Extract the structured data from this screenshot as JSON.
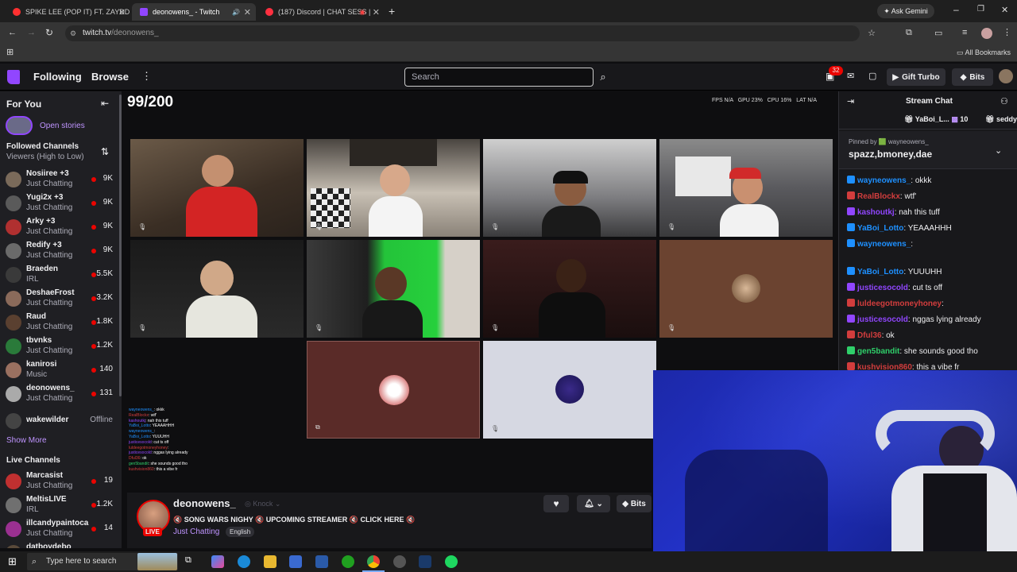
{
  "browser": {
    "tabs": [
      {
        "title": "SPIKE LEE (POP IT) FT. ZAYDD &"
      },
      {
        "title": "deonowens_ - Twitch"
      },
      {
        "title": "(187) Discord | CHAT SESS |"
      }
    ],
    "ask_gemini": "Ask Gemini",
    "url_host": "twitch.tv",
    "url_path": "/deonowens_",
    "all_bookmarks": "All Bookmarks"
  },
  "topnav": {
    "following": "Following",
    "browse": "Browse",
    "search_placeholder": "Search",
    "notif_count": "32",
    "gift_turbo": "Gift Turbo",
    "bits": "Bits"
  },
  "sidebar": {
    "for_you": "For You",
    "open_stories": "Open stories",
    "followed_title": "Followed Channels",
    "followed_sort": "Viewers (High to Low)",
    "followed": [
      {
        "name": "Nosiiree +3",
        "category": "Just Chatting",
        "viewers": "9K",
        "color": "#7a6a5a"
      },
      {
        "name": "Yugi2x +3",
        "category": "Just Chatting",
        "viewers": "9K",
        "color": "#5a5a5a"
      },
      {
        "name": "Arky +3",
        "category": "Just Chatting",
        "viewers": "9K",
        "color": "#b03030"
      },
      {
        "name": "Redify +3",
        "category": "Just Chatting",
        "viewers": "9K",
        "color": "#6a6a6a"
      },
      {
        "name": "Braeden",
        "category": "IRL",
        "viewers": "5.5K",
        "color": "#3a3a3a"
      },
      {
        "name": "DeshaeFrost",
        "category": "Just Chatting",
        "viewers": "3.2K",
        "color": "#8a6a5a"
      },
      {
        "name": "Raud",
        "category": "Just Chatting",
        "viewers": "1.8K",
        "color": "#5a4030"
      },
      {
        "name": "tbvnks",
        "category": "Just Chatting",
        "viewers": "1.2K",
        "color": "#2a7a3a"
      },
      {
        "name": "kanirosi",
        "category": "Music",
        "viewers": "140",
        "color": "#9a7060"
      },
      {
        "name": "deonowens_",
        "category": "Just Chatting",
        "viewers": "131",
        "color": "#aaaaaa"
      }
    ],
    "offline": {
      "name": "wakewilder",
      "status": "Offline"
    },
    "show_more": "Show More",
    "live_title": "Live Channels",
    "live": [
      {
        "name": "Marcasist",
        "category": "Just Chatting",
        "viewers": "19",
        "color": "#c03030"
      },
      {
        "name": "MeltisLIVE",
        "category": "IRL",
        "viewers": "1.2K",
        "color": "#707070"
      },
      {
        "name": "illcandypaintoca",
        "category": "Just Chatting",
        "viewers": "14",
        "color": "#9a3090"
      },
      {
        "name": "datboydebo",
        "category": "",
        "viewers": "142",
        "color": "#5a4a3a"
      }
    ]
  },
  "stream": {
    "counter": "99/200",
    "stats": [
      "FPS N/A",
      "GPU 23%",
      "CPU 16%",
      "LAT N/A"
    ]
  },
  "channel": {
    "name": "deonowens_",
    "live": "LIVE",
    "knock": "Knock",
    "title": "🔇 SONG WARS NIGHY 🔇 UPCOMING STREAMER 🔇 CLICK HERE 🔇",
    "category": "Just Chatting",
    "tag": "English",
    "bits": "Bits"
  },
  "chat": {
    "header": "Stream Chat",
    "pinned_by": "Pinned by 🟩 wayneowens_",
    "pinned_text": "spazz,bmoney,dae",
    "top_user": "YaBoi_L...",
    "top_count": "10",
    "top_user2": "seddy",
    "messages": [
      {
        "user": "wayneowens_",
        "color": "#1e90ff",
        "text": ": okkk"
      },
      {
        "user": "RealBlockx",
        "color": "#d23d3d",
        "text": ": wtf'"
      },
      {
        "user": "kashoutkj",
        "color": "#9146ff",
        "text": ": nah this tuff"
      },
      {
        "user": "YaBoi_Lotto",
        "color": "#1e90ff",
        "text": ": YEAAAHHH"
      },
      {
        "user": "wayneowens_",
        "color": "#1e90ff",
        "text": ":"
      },
      {
        "user": "YaBoi_Lotto",
        "color": "#1e90ff",
        "text": ": YUUUHH"
      },
      {
        "user": "justicesocold",
        "color": "#9146ff",
        "text": ": cut ts off"
      },
      {
        "user": "luldeegotmoneyhoney",
        "color": "#d23d3d",
        "text": ":"
      },
      {
        "user": "justicesocold",
        "color": "#9146ff",
        "text": ": nggas lying already"
      },
      {
        "user": "Dful36",
        "color": "#d23d3d",
        "text": ": ok"
      },
      {
        "user": "gen5bandit",
        "color": "#2fcf6a",
        "text": ": she sounds good tho"
      },
      {
        "user": "kushvision860",
        "color": "#d23d3d",
        "text": ": this a vibe fr"
      }
    ]
  },
  "taskbar": {
    "search": "Type here to search"
  }
}
